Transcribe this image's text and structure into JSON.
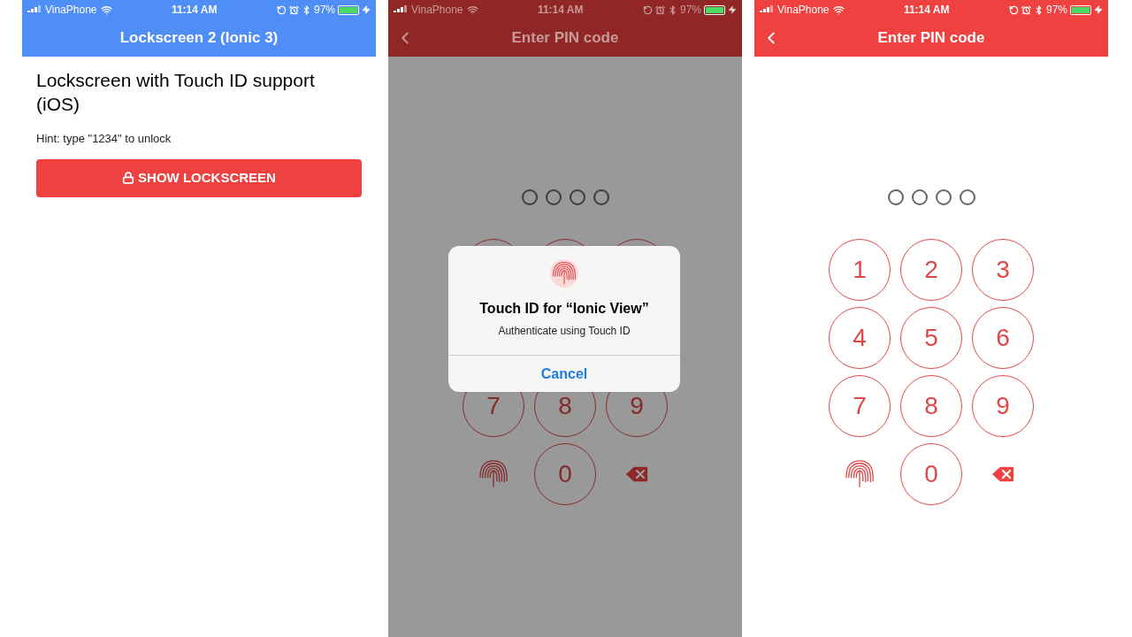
{
  "screens": [
    {
      "status_bar": {
        "carrier": "VinaPhone",
        "time": "11:14 AM",
        "battery": "97%"
      },
      "nav_bar": {
        "title": "Lockscreen 2 (Ionic 3)",
        "back": false,
        "color": "#4f8ef7"
      },
      "content": {
        "kind": "home",
        "heading": "Lockscreen with Touch ID support (iOS)",
        "hint": "Hint: type \"1234\" to unlock",
        "button": "SHOW LOCKSCREEN"
      }
    },
    {
      "status_bar": {
        "carrier": "VinaPhone",
        "time": "11:14 AM",
        "battery": "97%"
      },
      "nav_bar": {
        "title": "Enter PIN code",
        "back": true,
        "color": "#902626"
      },
      "content": {
        "kind": "pin",
        "dots": [
          {
            "filled": false
          },
          {
            "filled": false
          },
          {
            "filled": false
          },
          {
            "filled": false
          }
        ],
        "keys": [
          {
            "kind": "digit"
          },
          {
            "kind": "digit"
          },
          {
            "kind": "digit"
          },
          {
            "kind": "covered"
          },
          {
            "kind": "covered"
          },
          {
            "kind": "covered"
          },
          {
            "kind": "digit",
            "label": "7"
          },
          {
            "kind": "digit",
            "label": "8"
          },
          {
            "kind": "digit",
            "label": "9"
          },
          {
            "kind": "fingerprint"
          },
          {
            "kind": "digit",
            "label": "0"
          },
          {
            "kind": "delete"
          }
        ]
      },
      "alert": {
        "title": "Touch ID for “Ionic View”",
        "message": "Authenticate using Touch ID",
        "button": "Cancel"
      }
    },
    {
      "status_bar": {
        "carrier": "VinaPhone",
        "time": "11:14 AM",
        "battery": "97%"
      },
      "nav_bar": {
        "title": "Enter PIN code",
        "back": true,
        "color": "#f04141"
      },
      "content": {
        "kind": "pin",
        "dots": [
          {
            "filled": false
          },
          {
            "filled": false
          },
          {
            "filled": false
          },
          {
            "filled": false
          }
        ],
        "keys": [
          {
            "kind": "digit",
            "label": "1"
          },
          {
            "kind": "digit",
            "label": "2"
          },
          {
            "kind": "digit",
            "label": "3"
          },
          {
            "kind": "digit",
            "label": "4"
          },
          {
            "kind": "digit",
            "label": "5"
          },
          {
            "kind": "digit",
            "label": "6"
          },
          {
            "kind": "digit",
            "label": "7"
          },
          {
            "kind": "digit",
            "label": "8"
          },
          {
            "kind": "digit",
            "label": "9"
          },
          {
            "kind": "fingerprint"
          },
          {
            "kind": "digit",
            "label": "0"
          },
          {
            "kind": "delete"
          }
        ]
      }
    }
  ]
}
